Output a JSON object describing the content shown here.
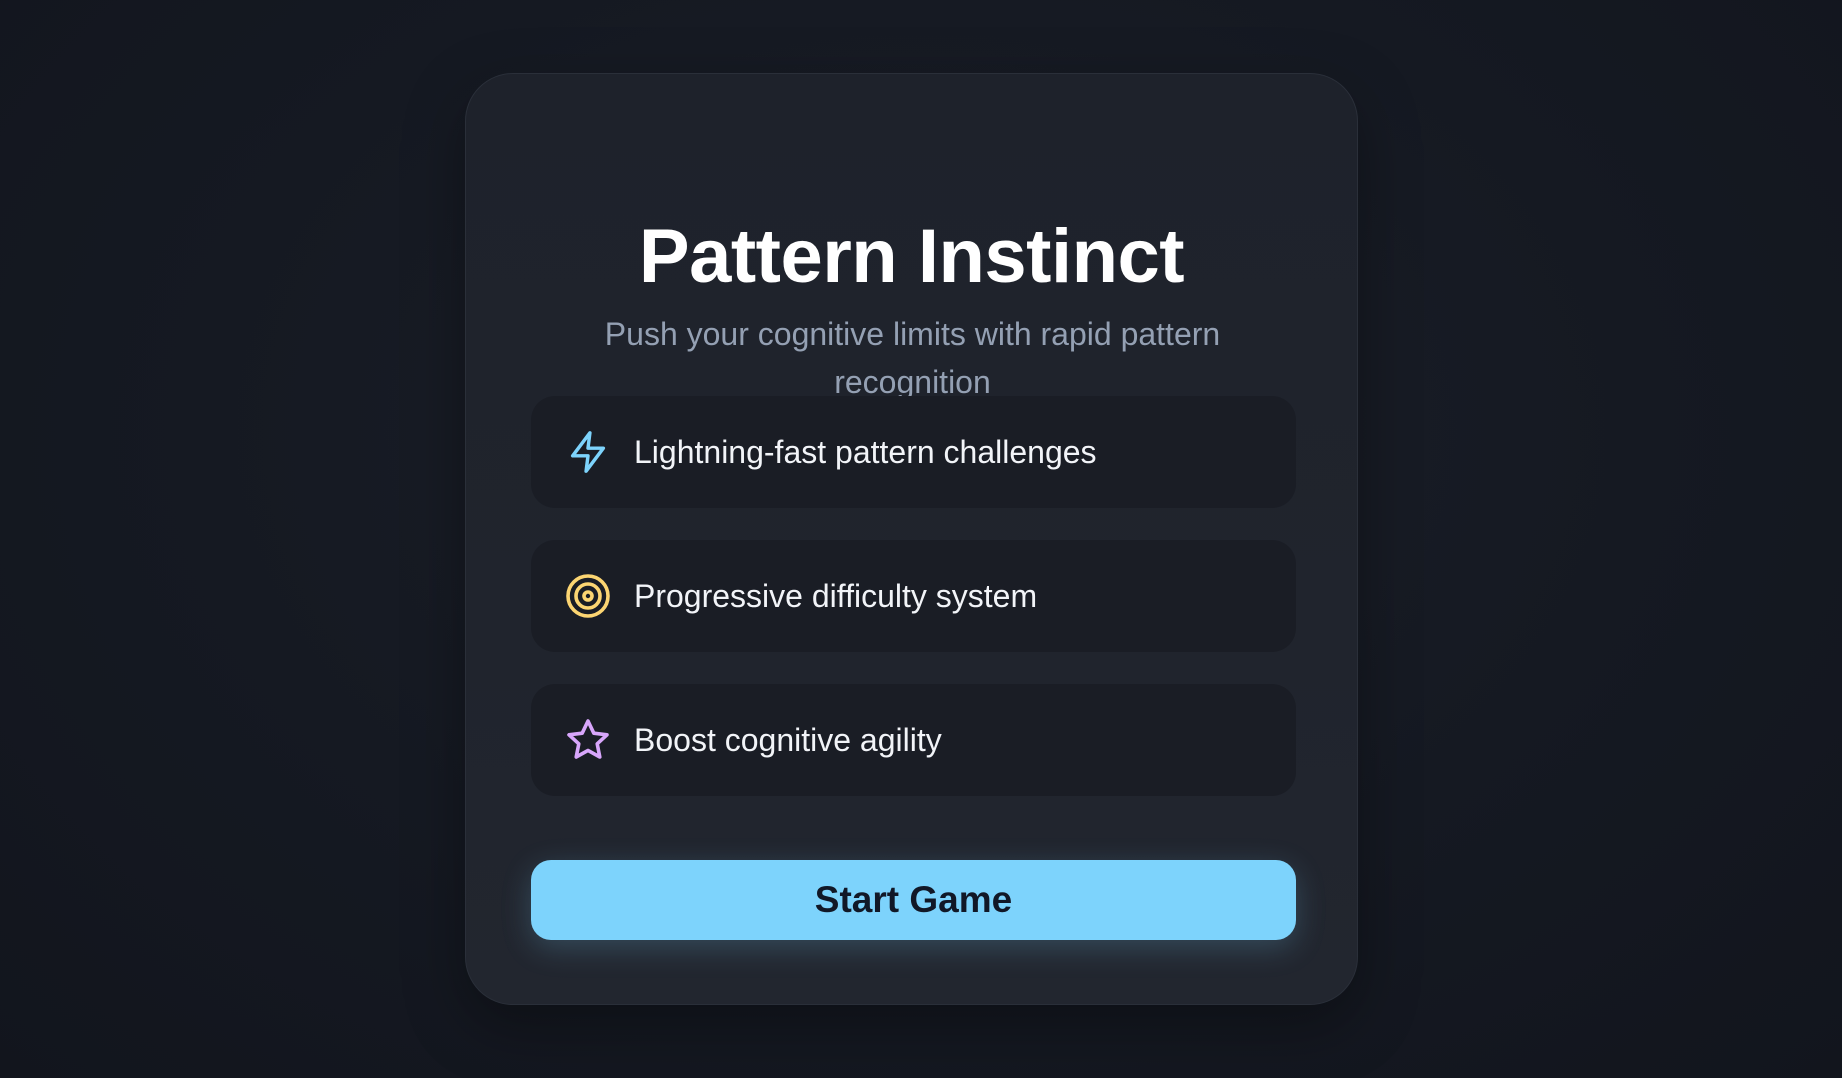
{
  "title": "Pattern Instinct",
  "subtitle": "Push your cognitive limits with rapid pattern recognition",
  "features": [
    {
      "icon": "lightning-bolt-icon",
      "color": "#7dd3fc",
      "label": "Lightning-fast pattern challenges"
    },
    {
      "icon": "target-icon",
      "color": "#fcd572",
      "label": "Progressive difficulty system"
    },
    {
      "icon": "star-icon",
      "color": "#d8a6fb",
      "label": "Boost cognitive agility"
    }
  ],
  "start_button": {
    "label": "Start Game",
    "color": "#7dd3fc"
  }
}
